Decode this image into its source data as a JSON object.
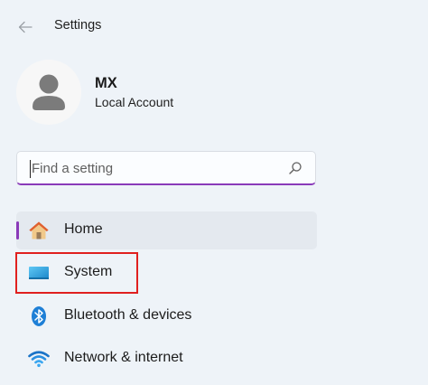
{
  "header": {
    "back_label": "←",
    "title": "Settings"
  },
  "profile": {
    "name": "MX",
    "account_type": "Local Account"
  },
  "search": {
    "placeholder": "Find a setting",
    "value": ""
  },
  "nav": {
    "items": [
      {
        "label": "Home",
        "icon": "home-icon",
        "selected": true
      },
      {
        "label": "System",
        "icon": "system-icon",
        "selected": false
      },
      {
        "label": "Bluetooth & devices",
        "icon": "bluetooth-icon",
        "selected": false
      },
      {
        "label": "Network & internet",
        "icon": "wifi-icon",
        "selected": false
      }
    ]
  },
  "colors": {
    "accent": "#8a3ab9",
    "highlight": "#e0201f",
    "background": "#eef3f8"
  }
}
